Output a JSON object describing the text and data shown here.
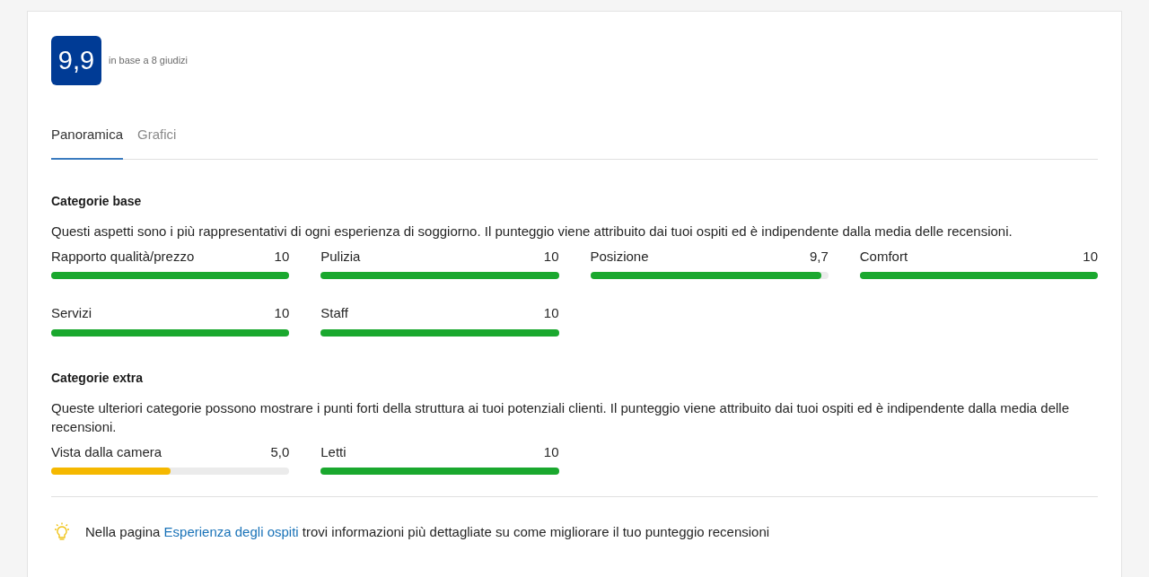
{
  "score": {
    "value": "9,9",
    "caption": "in base a 8 giudizi"
  },
  "tabs": [
    {
      "label": "Panoramica",
      "selected": true
    },
    {
      "label": "Grafici",
      "selected": false
    }
  ],
  "sections": [
    {
      "title": "Categorie base",
      "description": "Questi aspetti sono i più rappresentativi di ogni esperienza di soggiorno. Il punteggio viene attribuito dai tuoi ospiti ed è indipendente dalla media delle recensioni.",
      "categories": [
        {
          "name": "Rapporto qualità/prezzo",
          "score": "10",
          "level": 1,
          "color": "#1aa82e"
        },
        {
          "name": "Pulizia",
          "score": "10",
          "level": 1,
          "color": "#1aa82e"
        },
        {
          "name": "Posizione",
          "score": "9,7",
          "level": 0.97,
          "color": "#1aa82e"
        },
        {
          "name": "Comfort",
          "score": "10",
          "level": 1,
          "color": "#1aa82e"
        },
        {
          "name": "Servizi",
          "score": "10",
          "level": 1,
          "color": "#1aa82e"
        },
        {
          "name": "Staff",
          "score": "10",
          "level": 1,
          "color": "#1aa82e"
        }
      ]
    },
    {
      "title": "Categorie extra",
      "description": "Queste ulteriori categorie possono mostrare i punti forti della struttura ai tuoi potenziali clienti. Il punteggio viene attribuito dai tuoi ospiti ed è indipendente dalla media delle recensioni.",
      "categories": [
        {
          "name": "Vista dalla camera",
          "score": "5,0",
          "level": 0.5,
          "color": "#f5b800"
        },
        {
          "name": "Letti",
          "score": "10",
          "level": 1,
          "color": "#1aa82e"
        }
      ]
    }
  ],
  "tip": {
    "before": "Nella pagina",
    "link": "Esperienza degli ospiti",
    "after": "trovi informazioni più dettagliate su come migliorare il tuo punteggio recensioni"
  }
}
